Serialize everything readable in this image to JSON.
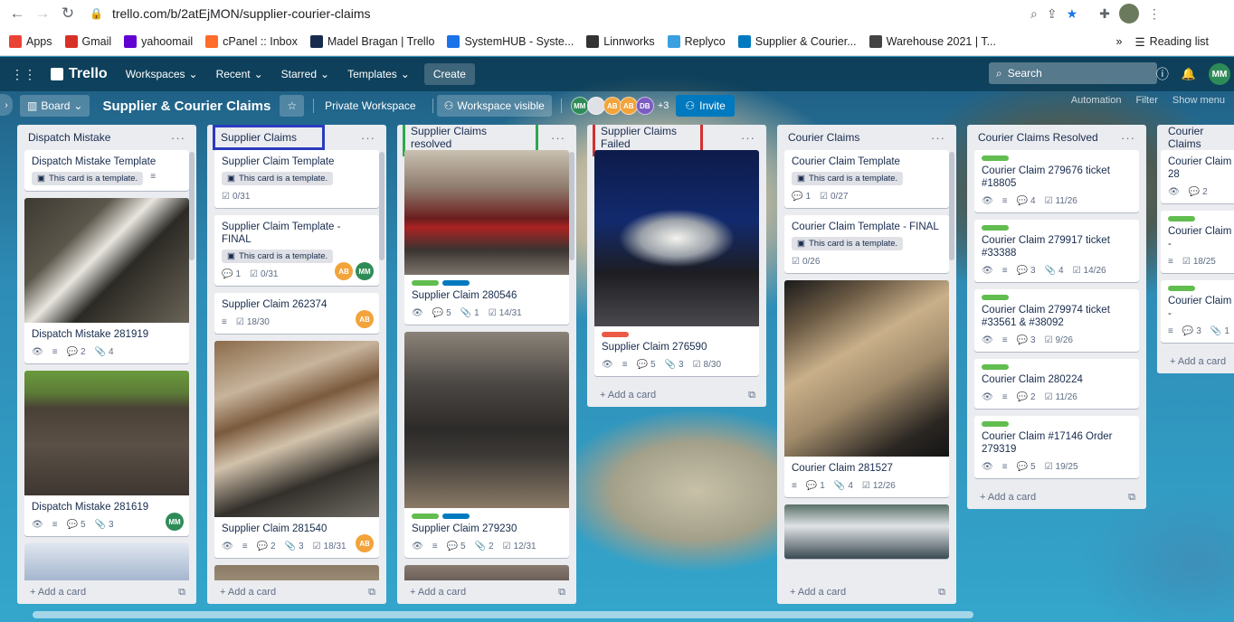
{
  "browser": {
    "url": "trello.com/b/2atEjMON/supplier-courier-claims",
    "bookmarks": [
      {
        "label": "Apps",
        "color": "#ea4335"
      },
      {
        "label": "Gmail",
        "color": "#d93025"
      },
      {
        "label": "yahoomail",
        "color": "#6001d2"
      },
      {
        "label": "cPanel :: Inbox",
        "color": "#ff6c2c"
      },
      {
        "label": "Madel Bragan | Trello",
        "color": "#172b4d"
      },
      {
        "label": "SystemHUB - Syste...",
        "color": "#1a73e8"
      },
      {
        "label": "Linnworks",
        "color": "#333333"
      },
      {
        "label": "Replyco",
        "color": "#3aa0e0"
      },
      {
        "label": "Supplier & Courier...",
        "color": "#0079bf"
      },
      {
        "label": "Warehouse 2021 | T...",
        "color": "#444444"
      }
    ],
    "more": "»",
    "reading_list": "Reading list"
  },
  "topbar": {
    "logo": "Trello",
    "workspaces": "Workspaces",
    "recent": "Recent",
    "starred": "Starred",
    "templates": "Templates",
    "create": "Create",
    "search_placeholder": "Search",
    "user_initials": "MM"
  },
  "board": {
    "view": "Board",
    "title": "Supplier & Courier Claims",
    "workspace": "Private Workspace",
    "visibility": "Workspace visible",
    "members": [
      {
        "initials": "MM",
        "color": "#2e8b57"
      },
      {
        "initials": "",
        "color": "#dfe1e6"
      },
      {
        "initials": "AB",
        "color": "#f2a33a"
      },
      {
        "initials": "AB",
        "color": "#f2a33a"
      },
      {
        "initials": "DB",
        "color": "#7b5cc2"
      }
    ],
    "extra_members": "+3",
    "invite": "Invite",
    "automation": "Automation",
    "filter": "Filter",
    "show_menu": "Show menu"
  },
  "lists": [
    {
      "title": "Dispatch Mistake",
      "add_card": "Add a card",
      "cards": [
        {
          "title": "Dispatch Mistake Template",
          "template": "This card is a template.",
          "badges": [
            {
              "icon": "≡",
              "text": ""
            }
          ]
        },
        {
          "title": "Dispatch Mistake 281919",
          "badges": [
            {
              "icon": "👁",
              "text": ""
            },
            {
              "icon": "≡",
              "text": ""
            },
            {
              "icon": "💬",
              "text": "2"
            },
            {
              "icon": "📎",
              "text": "4"
            }
          ]
        },
        {
          "title": "Dispatch Mistake 281619",
          "badges": [
            {
              "icon": "👁",
              "text": ""
            },
            {
              "icon": "≡",
              "text": ""
            },
            {
              "icon": "💬",
              "text": "5"
            },
            {
              "icon": "📎",
              "text": "3"
            }
          ],
          "members": [
            "MM"
          ]
        }
      ]
    },
    {
      "title": "Supplier Claims",
      "add_card": "Add a card",
      "cards": [
        {
          "title": "Supplier Claim Template",
          "template": "This card is a template.",
          "badges": [
            {
              "icon": "☑",
              "text": "0/31"
            }
          ]
        },
        {
          "title": "Supplier Claim Template - FINAL",
          "template": "This card is a template.",
          "badges": [
            {
              "icon": "💬",
              "text": "1"
            },
            {
              "icon": "☑",
              "text": "0/31"
            }
          ],
          "members": [
            "AB",
            "MM"
          ]
        },
        {
          "title": "Supplier Claim 262374",
          "badges": [
            {
              "icon": "≡",
              "text": ""
            },
            {
              "icon": "☑",
              "text": "18/30"
            }
          ],
          "members": [
            "AB"
          ]
        },
        {
          "title": "Supplier Claim 281540",
          "badges": [
            {
              "icon": "👁",
              "text": ""
            },
            {
              "icon": "≡",
              "text": ""
            },
            {
              "icon": "💬",
              "text": "2"
            },
            {
              "icon": "📎",
              "text": "3"
            },
            {
              "icon": "☑",
              "text": "18/31"
            }
          ],
          "members": [
            "AB"
          ]
        }
      ]
    },
    {
      "title": "Supplier Claims resolved",
      "add_card": "Add a card",
      "cards": [
        {
          "title": "Supplier Claim 280546",
          "badges": [
            {
              "icon": "👁",
              "text": ""
            },
            {
              "icon": "💬",
              "text": "5"
            },
            {
              "icon": "📎",
              "text": "1"
            },
            {
              "icon": "☑",
              "text": "14/31"
            }
          ]
        },
        {
          "title": "Supplier Claim 279230",
          "badges": [
            {
              "icon": "👁",
              "text": ""
            },
            {
              "icon": "≡",
              "text": ""
            },
            {
              "icon": "💬",
              "text": "5"
            },
            {
              "icon": "📎",
              "text": "2"
            },
            {
              "icon": "☑",
              "text": "12/31"
            }
          ]
        }
      ]
    },
    {
      "title": "Supplier Claims Failed",
      "add_card": "Add a card",
      "cards": [
        {
          "title": "Supplier Claim 276590",
          "badges": [
            {
              "icon": "👁",
              "text": ""
            },
            {
              "icon": "≡",
              "text": ""
            },
            {
              "icon": "💬",
              "text": "5"
            },
            {
              "icon": "📎",
              "text": "3"
            },
            {
              "icon": "☑",
              "text": "8/30"
            }
          ]
        }
      ]
    },
    {
      "title": "Courier Claims",
      "add_card": "Add a card",
      "cards": [
        {
          "title": "Courier Claim Template",
          "template": "This card is a template.",
          "badges": [
            {
              "icon": "💬",
              "text": "1"
            },
            {
              "icon": "☑",
              "text": "0/27"
            }
          ]
        },
        {
          "title": "Courier Claim Template - FINAL",
          "template": "This card is a template.",
          "badges": [
            {
              "icon": "☑",
              "text": "0/26"
            }
          ]
        },
        {
          "title": "Courier Claim 281527",
          "badges": [
            {
              "icon": "≡",
              "text": ""
            },
            {
              "icon": "💬",
              "text": "1"
            },
            {
              "icon": "📎",
              "text": "4"
            },
            {
              "icon": "☑",
              "text": "12/26"
            }
          ]
        }
      ]
    },
    {
      "title": "Courier Claims Resolved",
      "add_card": "Add a card",
      "cards": [
        {
          "title": "Courier Claim 279676 ticket #18805",
          "badges": [
            {
              "icon": "👁",
              "text": ""
            },
            {
              "icon": "≡",
              "text": ""
            },
            {
              "icon": "💬",
              "text": "4"
            },
            {
              "icon": "☑",
              "text": "11/26"
            }
          ]
        },
        {
          "title": "Courier Claim 279917 ticket #33388",
          "badges": [
            {
              "icon": "👁",
              "text": ""
            },
            {
              "icon": "≡",
              "text": ""
            },
            {
              "icon": "💬",
              "text": "3"
            },
            {
              "icon": "📎",
              "text": "4"
            },
            {
              "icon": "☑",
              "text": "14/26"
            }
          ]
        },
        {
          "title": "Courier Claim 279974 ticket #33561 & #38092",
          "badges": [
            {
              "icon": "👁",
              "text": ""
            },
            {
              "icon": "≡",
              "text": ""
            },
            {
              "icon": "💬",
              "text": "3"
            },
            {
              "icon": "☑",
              "text": "9/26"
            }
          ]
        },
        {
          "title": "Courier Claim 280224",
          "badges": [
            {
              "icon": "👁",
              "text": ""
            },
            {
              "icon": "≡",
              "text": ""
            },
            {
              "icon": "💬",
              "text": "2"
            },
            {
              "icon": "☑",
              "text": "11/26"
            }
          ]
        },
        {
          "title": "Courier Claim #17146 Order 279319",
          "badges": [
            {
              "icon": "👁",
              "text": ""
            },
            {
              "icon": "≡",
              "text": ""
            },
            {
              "icon": "💬",
              "text": "5"
            },
            {
              "icon": "☑",
              "text": "19/25"
            }
          ]
        }
      ]
    },
    {
      "title": "Courier Claims",
      "add_card": "Add a card",
      "cards": [
        {
          "title": "Courier Claim 28",
          "badges": [
            {
              "icon": "👁",
              "text": ""
            },
            {
              "icon": "💬",
              "text": "2"
            }
          ]
        },
        {
          "title": "Courier Claim -",
          "badges": [
            {
              "icon": "≡",
              "text": ""
            },
            {
              "icon": "☑",
              "text": "18/25"
            }
          ]
        },
        {
          "title": "Courier Claim -",
          "badges": [
            {
              "icon": "≡",
              "text": ""
            },
            {
              "icon": "💬",
              "text": "3"
            },
            {
              "icon": "📎",
              "text": "1"
            }
          ]
        }
      ]
    }
  ]
}
